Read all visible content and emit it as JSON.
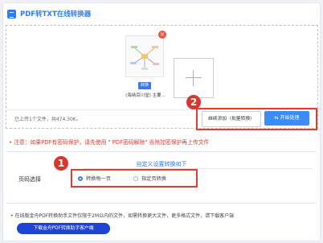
{
  "header": {
    "title": "PDF转TXT在线转换器",
    "icon": "document-icon"
  },
  "upload": {
    "file": {
      "format_badge": "转换",
      "name": "(海纳百川堂) 主要...",
      "close_symbol": "×"
    },
    "add_symbol": "+",
    "count_text": "已上传1个文件，共474.30K。",
    "continue_label": "继续添加（批量转换）",
    "start_label": "开始处理"
  },
  "callouts": {
    "one": "1",
    "two": "2"
  },
  "warning": "• 注意：如果PDF有密码保护，请先使用 \" PDF密码解除\" 去除加密保护再上传文件",
  "settings": {
    "title": "自定义设置转换如下",
    "page_label": "页码选择",
    "options": [
      {
        "label": "转换每一页",
        "selected": true
      },
      {
        "label": "指定页转换",
        "selected": false
      }
    ]
  },
  "footer": {
    "tip": "• 在线版金舟PDF转换助手文件仅限于2M以内的文件，如需转换更大文件，更多格式文件，请下载客户端",
    "download_label": "下载金舟PDF转换助手客户端"
  },
  "colors": {
    "accent": "#2f7cf6",
    "warning": "#e6392e",
    "highlight": "#e33b2e",
    "download": "#1e44d6"
  }
}
